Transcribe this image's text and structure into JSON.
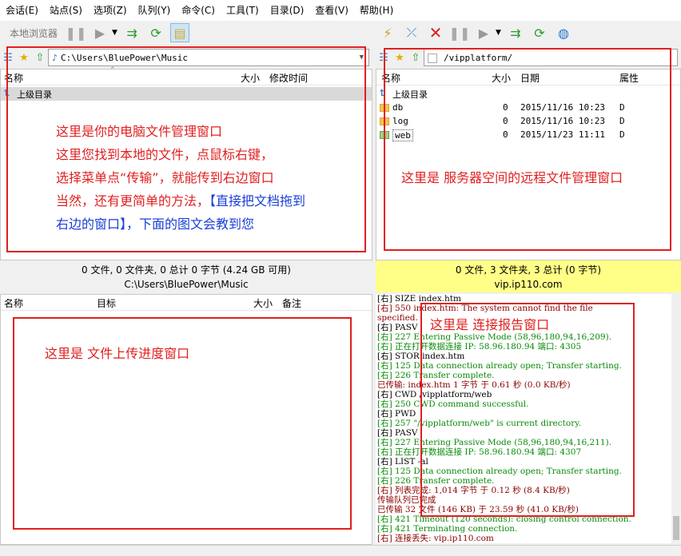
{
  "menu": [
    "会话(E)",
    "站点(S)",
    "选项(Z)",
    "队列(Y)",
    "命令(C)",
    "工具(T)",
    "目录(D)",
    "查看(V)",
    "帮助(H)"
  ],
  "toolbar_left": {
    "label": "本地浏览器"
  },
  "local": {
    "path": "C:\\Users\\BluePower\\Music",
    "cols": {
      "name": "名称",
      "size": "大小",
      "mtime": "修改时间"
    },
    "up": "上级目录",
    "status1": "0 文件, 0 文件夹, 0 总计 0 字节 (4.24 GB 可用)",
    "status2": "C:\\Users\\BluePower\\Music"
  },
  "remote": {
    "path": "/vipplatform/",
    "cols": {
      "name": "名称",
      "size": "大小",
      "date": "日期",
      "attr": "属性"
    },
    "up": "上级目录",
    "rows": [
      {
        "name": "db",
        "size": "0",
        "date": "2015/11/16 10:23",
        "attr": "D"
      },
      {
        "name": "log",
        "size": "0",
        "date": "2015/11/16 10:23",
        "attr": "D"
      },
      {
        "name": "web",
        "size": "0",
        "date": "2015/11/23 11:11",
        "attr": "D"
      }
    ],
    "status1": "0 文件, 3 文件夹, 3 总计 (0 字节)",
    "status2": "vip.ip110.com"
  },
  "queue": {
    "cols": {
      "name": "名称",
      "target": "目标",
      "size": "大小",
      "note": "备注"
    }
  },
  "notes": {
    "local_lines": [
      "这里是你的电脑文件管理窗口",
      "这里您找到本地的文件，点鼠标右键，",
      "选择菜单点“传输”，就能传到右边窗口",
      "当然，还有更简单的方法，"
    ],
    "local_blue_a": "【直接把文档拖到",
    "local_blue_b": "右边的窗口】，下面的图文会教到您",
    "remote": "这里是 服务器空间的远程文件管理窗口",
    "queue": "这里是 文件上传进度窗口",
    "log": "这里是 连接报告窗口"
  },
  "log": [
    {
      "c": "k",
      "t": "[右] SIZE index.htm"
    },
    {
      "c": "d",
      "t": "[右] 550 index.htm: The system cannot find the file"
    },
    {
      "c": "d",
      "t": "specified."
    },
    {
      "c": "k",
      "t": "[右] PASV"
    },
    {
      "c": "g",
      "t": "[右] 227 Entering Passive Mode (58,96,180,94,16,209)."
    },
    {
      "c": "g",
      "t": "[右] 正在打开数据连接 IP: 58.96.180.94 端口: 4305"
    },
    {
      "c": "k",
      "t": "[右] STOR index.htm"
    },
    {
      "c": "g",
      "t": "[右] 125 Data connection already open; Transfer starting."
    },
    {
      "c": "g",
      "t": "[右] 226 Transfer complete."
    },
    {
      "c": "d",
      "t": "已传输: index.htm 1 字节 于 0.61 秒 (0.0 KB/秒)"
    },
    {
      "c": "k",
      "t": "[右] CWD /vipplatform/web"
    },
    {
      "c": "g",
      "t": "[右] 250 CWD command successful."
    },
    {
      "c": "k",
      "t": "[右] PWD"
    },
    {
      "c": "g",
      "t": "[右] 257 \"/vipplatform/web\" is current directory."
    },
    {
      "c": "k",
      "t": "[右] PASV"
    },
    {
      "c": "g",
      "t": "[右] 227 Entering Passive Mode (58,96,180,94,16,211)."
    },
    {
      "c": "g",
      "t": "[右] 正在打开数据连接 IP: 58.96.180.94 端口: 4307"
    },
    {
      "c": "k",
      "t": "[右] LIST -al"
    },
    {
      "c": "g",
      "t": "[右] 125 Data connection already open; Transfer starting."
    },
    {
      "c": "g",
      "t": "[右] 226 Transfer complete."
    },
    {
      "c": "d",
      "t": "[右] 列表完成: 1,014 字节 于 0.12 秒 (8.4 KB/秒)"
    },
    {
      "c": "d",
      "t": "传输队列已完成"
    },
    {
      "c": "d",
      "t": "已传输 32 文件 (146 KB) 于 23.59 秒 (41.0 KB/秒)"
    },
    {
      "c": "g",
      "t": "[右] 421 Timeout (120 seconds): closing control connection."
    },
    {
      "c": "g",
      "t": "[右] 421 Terminating connection."
    },
    {
      "c": "d",
      "t": "[右] 连接丢失: vip.ip110.com"
    }
  ]
}
